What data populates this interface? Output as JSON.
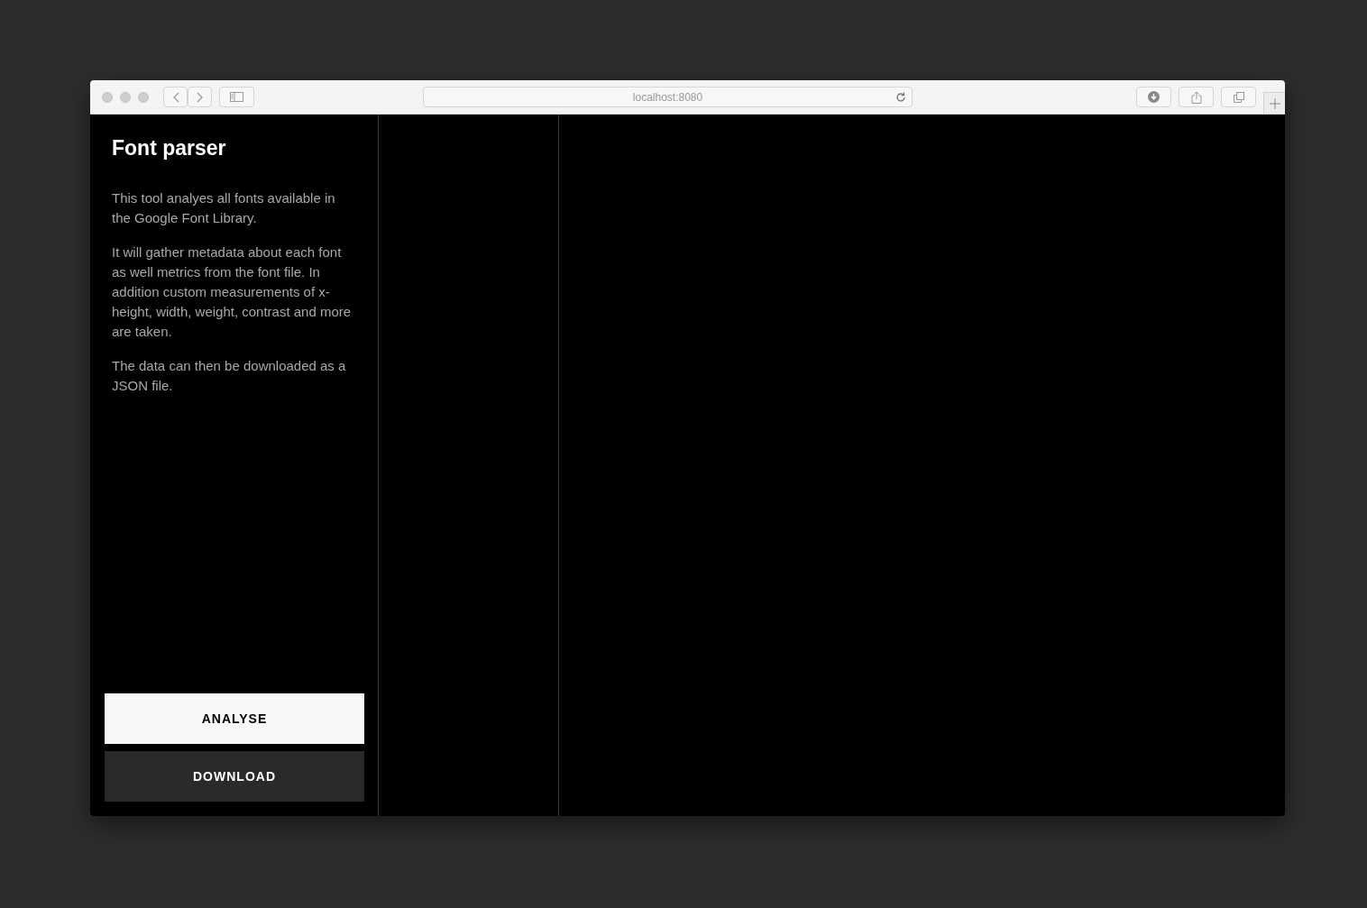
{
  "browser": {
    "address": "localhost:8080"
  },
  "sidebar": {
    "title": "Font parser",
    "paragraphs": [
      "This tool analyes all fonts available in the Google Font Library.",
      "It will gather metadata about each font as well metrics from the font file. In addition custom measurements of x-height, width, weight, contrast and more are taken.",
      "The data can then be downloaded as a JSON file."
    ],
    "buttons": [
      {
        "label": "ANALYSE",
        "kind": "light"
      },
      {
        "label": "DOWNLOAD",
        "kind": "dark"
      }
    ]
  }
}
